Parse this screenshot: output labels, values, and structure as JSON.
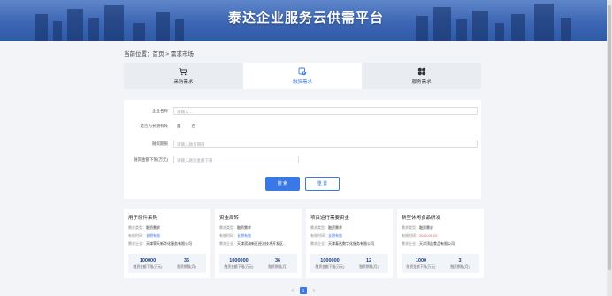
{
  "banner": {
    "title": "泰达企业服务云供需平台"
  },
  "breadcrumb": {
    "text": "当前位置：首页 > 需求市场"
  },
  "tabs": [
    {
      "label": "采购需求",
      "icon": "cart-icon",
      "active": false
    },
    {
      "label": "融资需求",
      "icon": "finance-icon",
      "active": true
    },
    {
      "label": "服务需求",
      "icon": "grid-icon",
      "active": false
    }
  ],
  "form": {
    "company_label": "企业名称",
    "company_placeholder": "请输入...",
    "longterm_label": "是否为长期有效",
    "longterm_options": [
      "是",
      "否"
    ],
    "period_label": "融资期限",
    "period_placeholder": "请输入融资期限",
    "amount_label": "融资金额下限(万元)",
    "amount_placeholder": "请输入融资金额下限",
    "search_label": "搜 索",
    "reset_label": "重 置"
  },
  "cards": [
    {
      "title": "用于原件采购",
      "type_label": "需求类型：",
      "type": "融资需求",
      "valid_label": "有效时间：",
      "valid": "长期有效",
      "valid_color": "blue",
      "company_label": "需求企业：",
      "company": "天津荣天新华化服务有限公司",
      "amount": "100000",
      "amount_label": "融资金额下限(万元)",
      "period": "36",
      "period_label": "融资期限(月)"
    },
    {
      "title": "资金周转",
      "type_label": "需求类型：",
      "type": "融资需求",
      "valid_label": "有效时间：",
      "valid": "长期有效",
      "valid_color": "blue",
      "company_label": "需求企业：",
      "company": "天津滨海新区经济技术开发区...",
      "amount": "1000000",
      "amount_label": "融资金额下限(万元)",
      "period": "36",
      "period_label": "融资期限(月)"
    },
    {
      "title": "项目运行需要资金",
      "type_label": "需求类型：",
      "type": "融资需求",
      "valid_label": "有效时间：",
      "valid": "长期有效",
      "valid_color": "blue",
      "company_label": "需求企业：",
      "company": "天津泰达数字化服务有限公司",
      "amount": "1000000",
      "amount_label": "融资金额下限(万元)",
      "period": "12",
      "period_label": "融资期限(月)"
    },
    {
      "title": "新型休闲食品研发",
      "type_label": "需求类型：",
      "type": "融资需求",
      "valid_label": "有效时间：",
      "valid": "2023-06-02",
      "valid_color": "red",
      "company_label": "需求企业：",
      "company": "天津顶益食品有限公司",
      "amount": "1000",
      "amount_label": "融资金额下限(万元)",
      "period": "3",
      "period_label": "融资期限(月)"
    }
  ],
  "pager": {
    "prev": "<",
    "current": "1",
    "next": ">"
  },
  "colors": {
    "accent": "#3a78e7",
    "banner": "#3d67b4",
    "background": "#f2f4f7",
    "stat_value": "#1d3f7a",
    "expiry": "#e05757"
  }
}
